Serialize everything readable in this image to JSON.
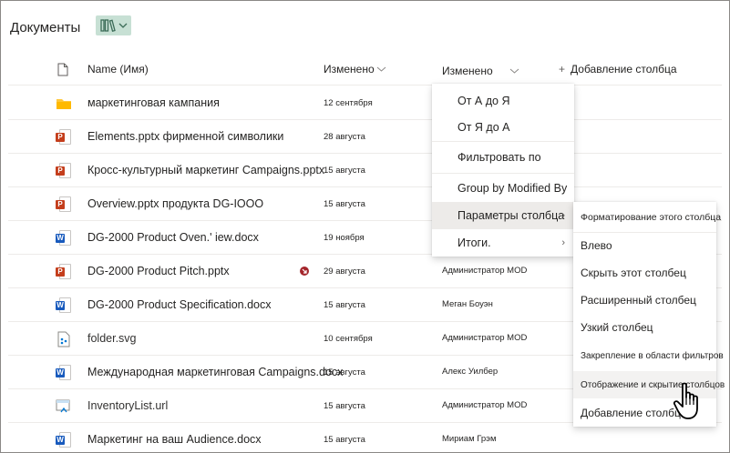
{
  "header": {
    "title": "Документы"
  },
  "columns": {
    "name": "Name (Имя)",
    "modified": "Изменено",
    "modified_by": "Изменено",
    "add_column": "Добавление столбца"
  },
  "rows": [
    {
      "type": "folder",
      "name": "маркетинговая кампания",
      "date": "12 сентября",
      "by": ""
    },
    {
      "type": "ppt",
      "name": "Elements.pptx фирменной символики",
      "date": "28 августа",
      "by": ""
    },
    {
      "type": "ppt",
      "name": "Кросс-культурный маркетинг Campaigns.pptx",
      "date": "15 августа",
      "by": ""
    },
    {
      "type": "ppt",
      "name": "Overview.pptx продукта DG-IOOO",
      "date": "15 августа",
      "by": ""
    },
    {
      "type": "word",
      "name": "DG-2000 Product Oven.' iew.docx",
      "date": "19 ноября",
      "by": ""
    },
    {
      "type": "ppt",
      "name": "DG-2000 Product Pitch.pptx",
      "date": "29 августа",
      "by": "Администратор MOD"
    },
    {
      "type": "word",
      "name": "DG-2000 Product Specification.docx",
      "date": "15 августа",
      "by": "Меган Боуэн"
    },
    {
      "type": "svg",
      "name": "folder.svg",
      "date": "10 сентября",
      "by": "Администратор MOD"
    },
    {
      "type": "word",
      "name": "Международная маркетинговая Campaigns.docx",
      "date": "15 августа",
      "by": "Алекс Уилбер"
    },
    {
      "type": "url",
      "name": "InventoryList.url",
      "date": "15 августа",
      "by": "Администратор MOD"
    },
    {
      "type": "word",
      "name": "Маркетинг на ваш Audience.docx",
      "date": "15 августа",
      "by": "Мириам Грэм"
    }
  ],
  "menu": {
    "items": [
      "От А до Я",
      "От Я до А",
      "Фильтровать по",
      "Group by Modified By",
      "Параметры столбца",
      "Итоги."
    ]
  },
  "submenu": {
    "items": [
      "Форматирование этого столбца",
      "Влево",
      "Скрыть этот столбец",
      "Расширенный столбец",
      "Узкий столбец",
      "Закрепление в области фильтров",
      "Отображение и скрытие столбцов",
      "Добавление столбца"
    ]
  },
  "colors": {
    "accent_view": "#c7e0d4",
    "ppt": "#c43e1c",
    "word": "#185abd",
    "folder": "#ffc83d",
    "alert": "#a4262c"
  }
}
